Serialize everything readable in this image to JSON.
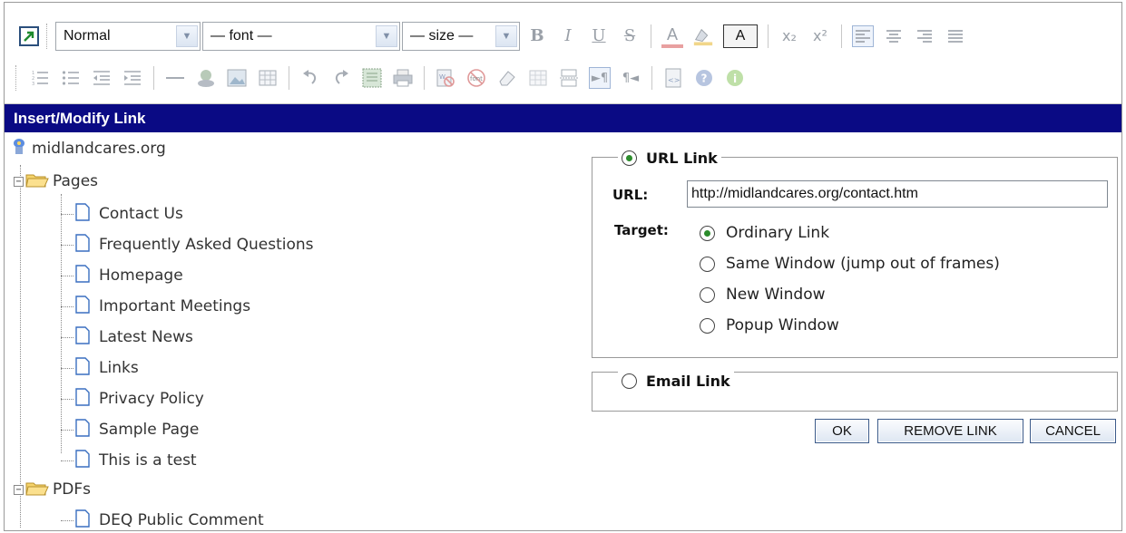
{
  "toolbar": {
    "format_select": "Normal",
    "font_select": "— font —",
    "size_select": "— size —",
    "bold": "B",
    "italic": "I",
    "underline": "U",
    "strikethrough": "S",
    "font_color": "A",
    "highlight": "A",
    "char_box": "A",
    "subscript": "x₂",
    "superscript": "x²",
    "row1_icons": [
      "toggle-html-icon",
      "bold-icon",
      "italic-icon",
      "underline-icon",
      "strikethrough-icon",
      "font-color-icon",
      "highlight-color-icon",
      "character-map-icon",
      "subscript-icon",
      "superscript-icon",
      "align-left-icon",
      "align-center-icon",
      "align-right-icon",
      "justify-icon"
    ],
    "row2_icons": [
      "ordered-list-icon",
      "unordered-list-icon",
      "outdent-icon",
      "indent-icon",
      "horizontal-rule-icon",
      "create-link-icon",
      "insert-image-icon",
      "insert-table-icon",
      "undo-icon",
      "redo-icon",
      "select-all-icon",
      "print-icon",
      "paste-from-word-icon",
      "remove-font-icon",
      "clear-formatting-icon",
      "table-grid-icon",
      "page-break-icon",
      "ltr-icon",
      "rtl-icon",
      "view-source-icon",
      "help-icon",
      "about-icon"
    ]
  },
  "dialog": {
    "title": "Insert/Modify Link"
  },
  "tree": {
    "root": "midlandcares.org",
    "folders": [
      {
        "name": "Pages",
        "items": [
          "Contact Us",
          "Frequently Asked Questions",
          "Homepage",
          "Important Meetings",
          "Latest News",
          "Links",
          "Privacy Policy",
          "Sample Page",
          "This is a test"
        ]
      },
      {
        "name": "PDFs",
        "items": [
          "DEQ Public Comment"
        ]
      }
    ]
  },
  "url_link": {
    "legend": "URL Link",
    "selected": true,
    "url_label": "URL:",
    "url_value": "http://midlandcares.org/contact.htm",
    "target_label": "Target:",
    "targets": [
      {
        "label": "Ordinary Link",
        "selected": true
      },
      {
        "label": "Same Window (jump out of frames)",
        "selected": false
      },
      {
        "label": "New Window",
        "selected": false
      },
      {
        "label": "Popup Window",
        "selected": false
      }
    ]
  },
  "email_link": {
    "legend": "Email Link",
    "selected": false
  },
  "buttons": {
    "ok": "OK",
    "remove_link": "REMOVE LINK",
    "cancel": "CANCEL"
  },
  "colors": {
    "title_bar": "#0a0a84",
    "radio_dot": "#2c8c2c",
    "button_border": "#3b5a8a"
  }
}
